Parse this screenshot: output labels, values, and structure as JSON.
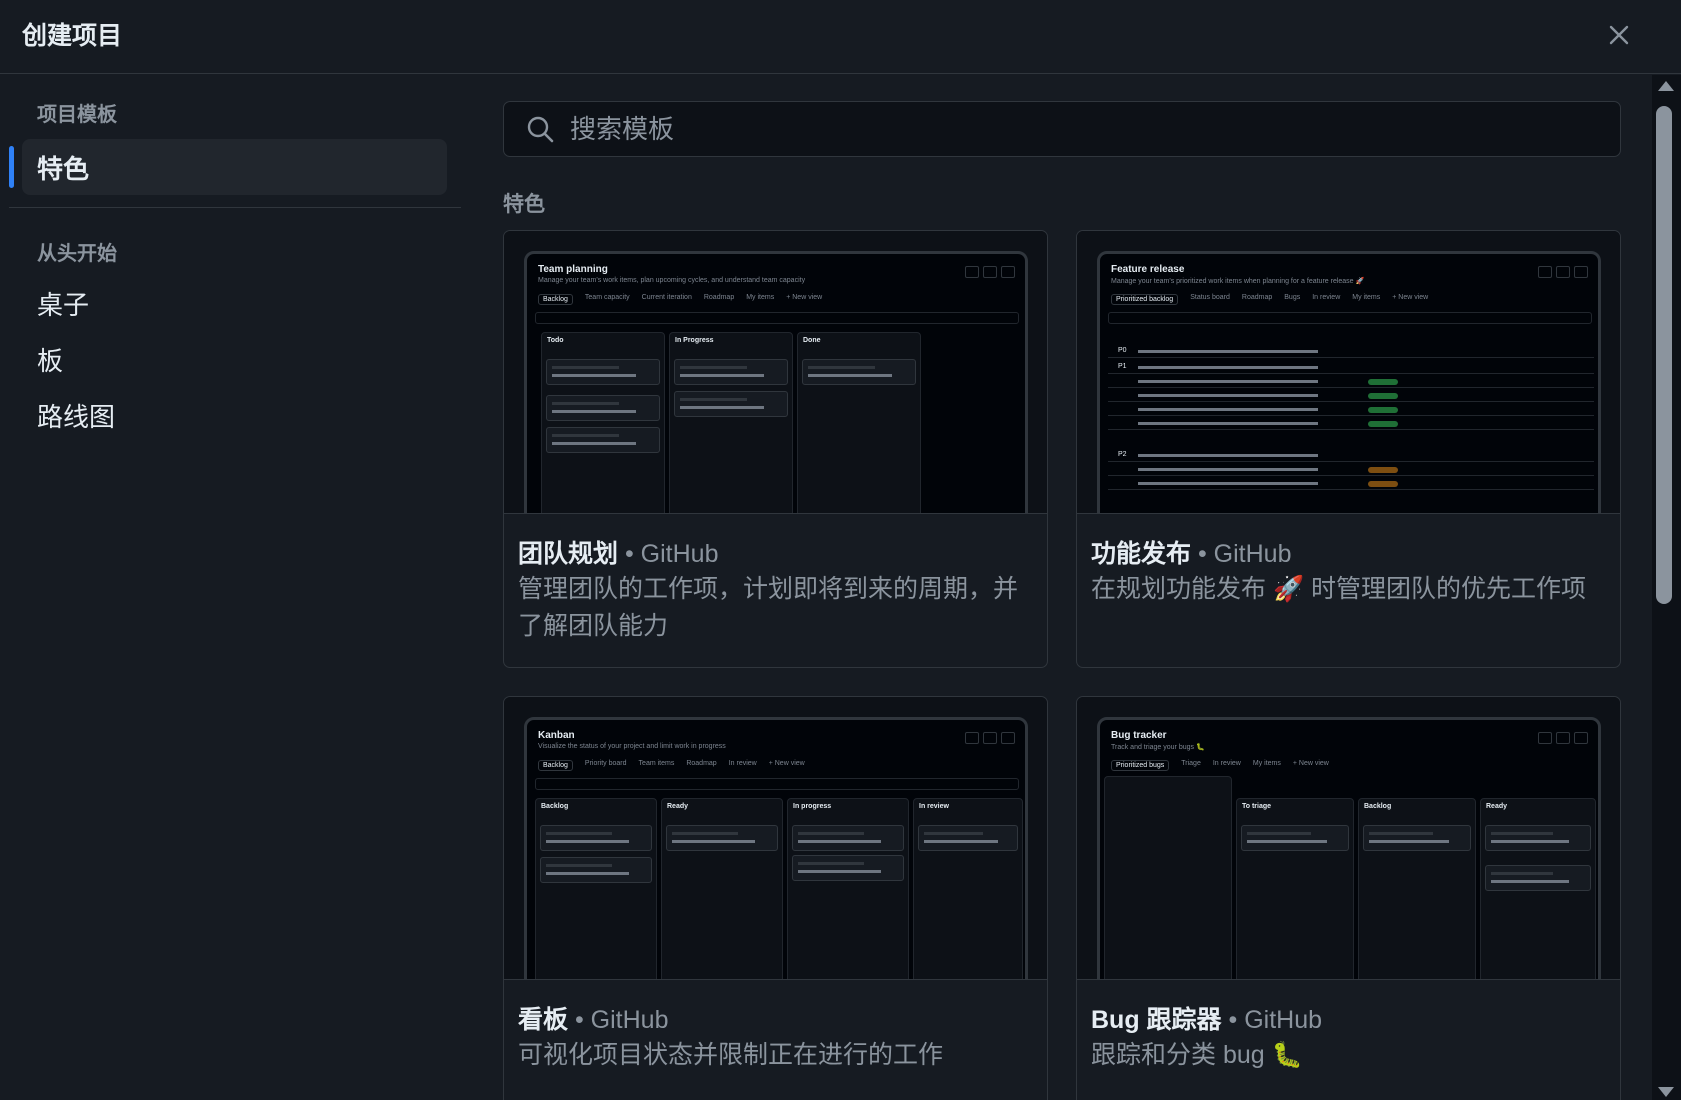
{
  "header": {
    "title": "创建项目"
  },
  "sidebar": {
    "templates_heading": "项目模板",
    "featured_label": "特色",
    "scratch_heading": "从头开始",
    "scratch_items": [
      "桌子",
      "板",
      "路线图"
    ]
  },
  "search": {
    "placeholder": "搜索模板"
  },
  "section_title": "特色",
  "templates": [
    {
      "name": "团队规划",
      "author": "• GitHub",
      "description": "管理团队的工作项，计划即将到来的周期，并了解团队能力",
      "preview": {
        "title": "Team planning",
        "subtitle": "Manage your team's work items, plan upcoming cycles, and understand team capacity",
        "tabs": [
          "Backlog",
          "Team capacity",
          "Current iteration",
          "Roadmap",
          "My items",
          "+ New view"
        ],
        "columns": [
          "Todo",
          "In Progress",
          "Done"
        ]
      }
    },
    {
      "name": "功能发布",
      "author": "• GitHub",
      "description": "在规划功能发布 🚀 时管理团队的优先工作项",
      "preview": {
        "title": "Feature release",
        "subtitle": "Manage your team's prioritized work items when planning for a feature release 🚀",
        "tabs": [
          "Prioritized backlog",
          "Status board",
          "Roadmap",
          "Bugs",
          "In review",
          "My items",
          "+ New view"
        ],
        "groups": [
          "P0",
          "P1",
          "P2"
        ]
      }
    },
    {
      "name": "看板",
      "author": "• GitHub",
      "description": "可视化项目状态并限制正在进行的工作",
      "preview": {
        "title": "Kanban",
        "subtitle": "Visualize the status of your project and limit work in progress",
        "tabs": [
          "Backlog",
          "Priority board",
          "Team items",
          "Roadmap",
          "In review",
          "+ New view"
        ],
        "columns": [
          "Backlog",
          "Ready",
          "In progress",
          "In review"
        ]
      }
    },
    {
      "name": "Bug 跟踪器",
      "author": "• GitHub",
      "description": "跟踪和分类 bug 🐛",
      "preview": {
        "title": "Bug tracker",
        "subtitle": "Track and triage your bugs 🐛",
        "tabs": [
          "Prioritized bugs",
          "Triage",
          "In review",
          "My items",
          "+ New view"
        ],
        "columns": [
          "To triage",
          "Backlog",
          "Ready"
        ]
      }
    }
  ]
}
